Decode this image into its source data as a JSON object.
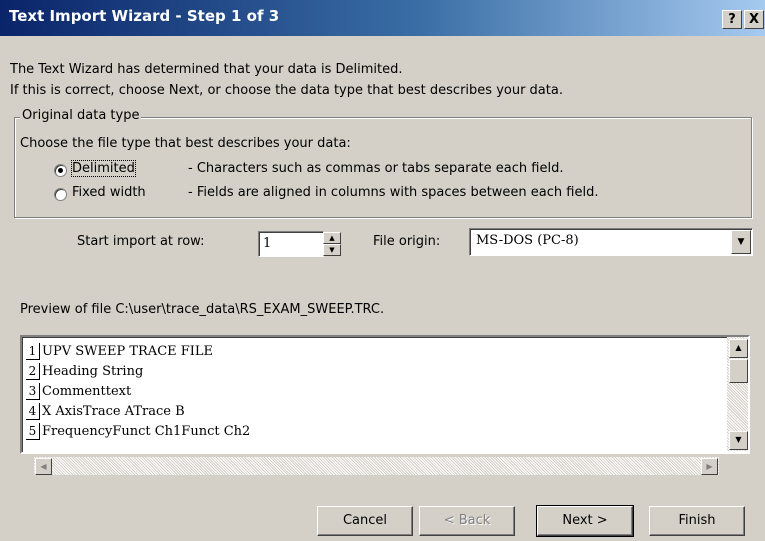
{
  "window": {
    "title": "Text Import Wizard - Step 1 of 3",
    "help_button": "?",
    "close_button": "X"
  },
  "intro": {
    "line1": "The Text Wizard has determined that your data is Delimited.",
    "line2": "If this is correct, choose Next, or choose the data type that best describes your data."
  },
  "group": {
    "legend": "Original data type",
    "prompt": "Choose the file type that best describes your data:",
    "options": [
      {
        "label": "Delimited",
        "description": "- Characters such as commas or tabs separate each field.",
        "selected": true
      },
      {
        "label": "Fixed width",
        "description": "- Fields are aligned in columns with spaces between each field.",
        "selected": false
      }
    ]
  },
  "start_row": {
    "label": "Start import at row:",
    "value": "1"
  },
  "file_origin": {
    "label": "File origin:",
    "value": "MS-DOS (PC-8)"
  },
  "preview": {
    "label": "Preview of file C:\\user\\trace_data\\RS_EXAM_SWEEP.TRC.",
    "rows": [
      {
        "num": "1",
        "text": "UPV SWEEP TRACE FILE"
      },
      {
        "num": "2",
        "text": "Heading String"
      },
      {
        "num": "3",
        "text": "Commenttext"
      },
      {
        "num": "4",
        "text": "X AxisTrace ATrace B"
      },
      {
        "num": "5",
        "text": "FrequencyFunct Ch1Funct Ch2"
      }
    ]
  },
  "buttons": {
    "cancel": "Cancel",
    "back": "< Back",
    "next": "Next >",
    "finish": "Finish"
  },
  "icons": {
    "up": "▲",
    "down": "▼",
    "left": "◀",
    "right": "▶"
  }
}
